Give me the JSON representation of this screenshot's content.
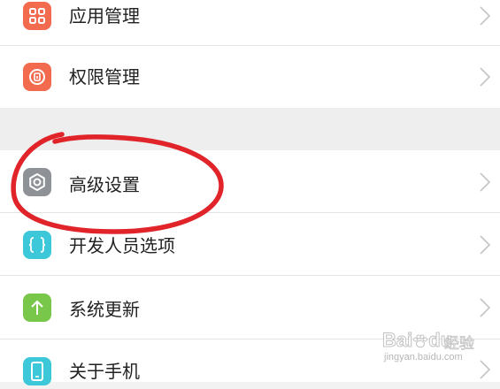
{
  "settings_list": {
    "items": [
      {
        "label": "应用管理",
        "icon": "app-manager-icon",
        "icon_color": "#f26b4e"
      },
      {
        "label": "权限管理",
        "icon": "permission-manager-icon",
        "icon_color": "#f26b4e"
      },
      {
        "label": "高级设置",
        "icon": "gear-icon",
        "icon_color": "#8e9196"
      },
      {
        "label": "开发人员选项",
        "icon": "braces-icon",
        "icon_color": "#3cc8d8"
      },
      {
        "label": "系统更新",
        "icon": "arrow-up-icon",
        "icon_color": "#78c74a"
      },
      {
        "label": "关于手机",
        "icon": "phone-icon",
        "icon_color": "#3cc8d8"
      }
    ]
  },
  "annotation": {
    "color": "#e0242a",
    "shape": "hand-drawn ellipse around 高级设置"
  },
  "watermark": {
    "brand": "Bai",
    "brand_suffix": "du",
    "product": "经验",
    "url": "jingyan.baidu.com"
  }
}
